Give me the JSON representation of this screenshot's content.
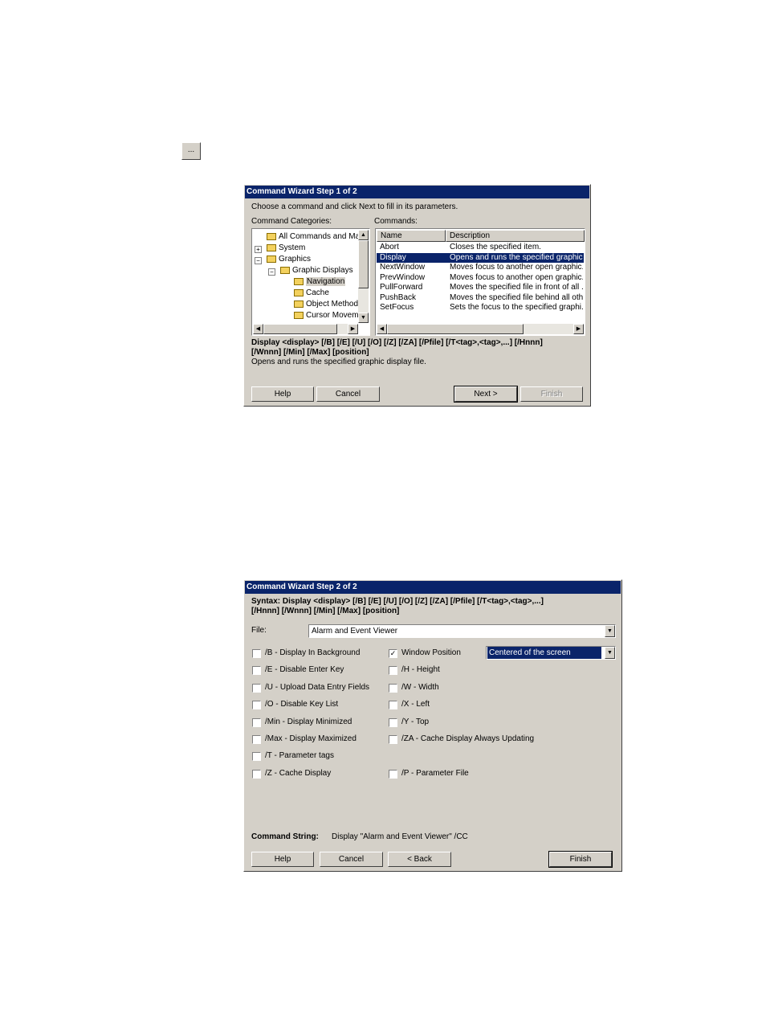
{
  "ellipsis_button": "...",
  "step1": {
    "title": "Command Wizard Step 1 of 2",
    "instruction": "Choose a command and click Next to fill in its parameters.",
    "categories_label": "Command Categories:",
    "commands_label": "Commands:",
    "tree": [
      "All Commands and Mac",
      "System",
      "Graphics",
      "Graphic Displays",
      "Navigation",
      "Cache",
      "Object Method",
      "Cursor Moveme"
    ],
    "columns": {
      "name": "Name",
      "description": "Description"
    },
    "commands": [
      {
        "name": "Abort",
        "description": "Closes the specified item."
      },
      {
        "name": "Display",
        "description": "Opens and runs the specified graphic..."
      },
      {
        "name": "NextWindow",
        "description": "Moves focus to another open graphic..."
      },
      {
        "name": "PrevWindow",
        "description": "Moves focus to another open graphic..."
      },
      {
        "name": "PullForward",
        "description": "Moves the specified file in front of all ..."
      },
      {
        "name": "PushBack",
        "description": "Moves the specified file behind all oth..."
      },
      {
        "name": "SetFocus",
        "description": "Sets the focus to the specified graphi..."
      }
    ],
    "syntax_line1": "Display <display> [/B] [/E] [/U] [/O] [/Z] [/ZA] [/Pfile] [/T<tag>,<tag>,...] [/Hnnn]",
    "syntax_line2": "[/Wnnn] [/Min] [/Max] [position]",
    "description": "Opens and runs the specified graphic display file.",
    "buttons": {
      "help": "Help",
      "cancel": "Cancel",
      "next": "Next >",
      "finish": "Finish"
    }
  },
  "step2": {
    "title": "Command Wizard Step 2 of 2",
    "syntax_line1": "Syntax: Display <display> [/B] [/E] [/U] [/O] [/Z] [/ZA] [/Pfile] [/T<tag>,<tag>,...]",
    "syntax_line2": "[/Hnnn] [/Wnnn] [/Min] [/Max] [position]",
    "file_label": "File:",
    "file_value": "Alarm and Event Viewer",
    "left_options": [
      {
        "label": "/B - Display In Background",
        "checked": false
      },
      {
        "label": "/E - Disable Enter Key",
        "checked": false
      },
      {
        "label": "/U - Upload Data Entry Fields",
        "checked": false
      },
      {
        "label": "/O - Disable Key List",
        "checked": false
      },
      {
        "label": "/Min - Display Minimized",
        "checked": false
      },
      {
        "label": "/Max - Display Maximized",
        "checked": false
      },
      {
        "label": "/T - Parameter tags",
        "checked": false
      },
      {
        "label": "/Z - Cache Display",
        "checked": false
      }
    ],
    "right_options": [
      {
        "label": "Window Position",
        "checked": true
      },
      {
        "label": "/H - Height",
        "checked": false
      },
      {
        "label": "/W - Width",
        "checked": false
      },
      {
        "label": "/X - Left",
        "checked": false
      },
      {
        "label": "/Y - Top",
        "checked": false
      },
      {
        "label": "/ZA - Cache Display Always Updating",
        "checked": false
      },
      {
        "label": "/P - Parameter File",
        "checked": false
      }
    ],
    "position_value": "Centered of the screen",
    "command_string_label": "Command String:",
    "command_string_value": "Display \"Alarm and Event Viewer\" /CC",
    "buttons": {
      "help": "Help",
      "cancel": "Cancel",
      "back": "< Back",
      "finish": "Finish"
    }
  }
}
